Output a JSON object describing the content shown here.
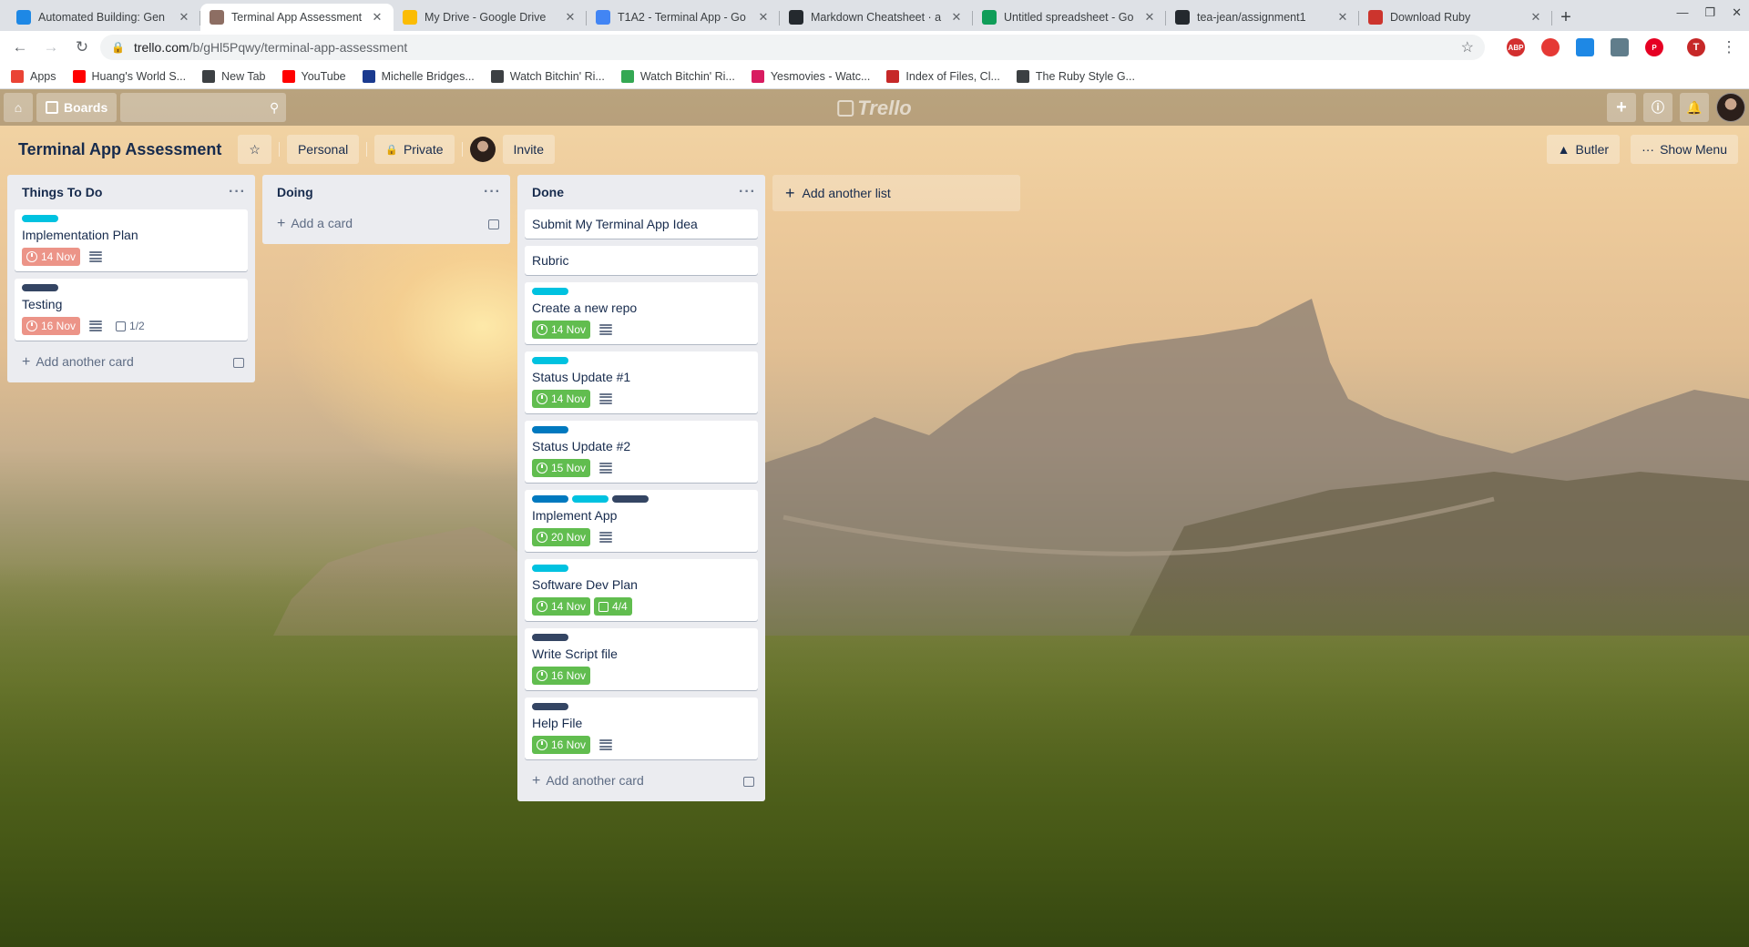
{
  "browser": {
    "tabs": [
      {
        "title": "Automated Building: Gen",
        "favicon_color": "#1e88e5",
        "active": false
      },
      {
        "title": "Terminal App Assessment",
        "favicon_color": "#8d6e63",
        "active": true
      },
      {
        "title": "My Drive - Google Drive",
        "favicon_color": "#fbbc04",
        "active": false
      },
      {
        "title": "T1A2 - Terminal App - Go",
        "favicon_color": "#4285f4",
        "active": false
      },
      {
        "title": "Markdown Cheatsheet · a",
        "favicon_color": "#24292e",
        "active": false
      },
      {
        "title": "Untitled spreadsheet - Go",
        "favicon_color": "#0f9d58",
        "active": false
      },
      {
        "title": "tea-jean/assignment1",
        "favicon_color": "#24292e",
        "active": false
      },
      {
        "title": "Download Ruby",
        "favicon_color": "#cc342d",
        "active": false
      }
    ],
    "url_host": "trello.com",
    "url_path": "/b/gHl5Pqwy/terminal-app-assessment",
    "profile_initial": "T",
    "bookmarks": [
      {
        "label": "Apps",
        "color": "#ea4335"
      },
      {
        "label": "Huang's World S...",
        "color": "#ff0000"
      },
      {
        "label": "New Tab",
        "color": "#3c4043"
      },
      {
        "label": "YouTube",
        "color": "#ff0000"
      },
      {
        "label": "Michelle Bridges...",
        "color": "#1a3a8f"
      },
      {
        "label": "Watch Bitchin' Ri...",
        "color": "#3c4043"
      },
      {
        "label": "Watch Bitchin' Ri...",
        "color": "#34a853"
      },
      {
        "label": "Yesmovies - Watc...",
        "color": "#d81b60"
      },
      {
        "label": "Index of Files, Cl...",
        "color": "#c62828"
      },
      {
        "label": "The Ruby Style G...",
        "color": "#3c4043"
      }
    ]
  },
  "header": {
    "boards_label": "Boards",
    "logo_text": "Trello"
  },
  "board": {
    "title": "Terminal App Assessment",
    "team_label": "Personal",
    "visibility_label": "Private",
    "invite_label": "Invite",
    "butler_label": "Butler",
    "show_menu_label": "Show Menu",
    "add_list_label": "Add another list"
  },
  "colors": {
    "label_sky": "#00c2e0",
    "label_navy": "#344563",
    "label_blue": "#0079bf",
    "due_late": "#ec9488",
    "due_complete": "#61bd4f"
  },
  "lists": [
    {
      "name": "Things To Do",
      "add_label": "Add another card",
      "cards": [
        {
          "title": "Implementation Plan",
          "labels": [
            "label_sky"
          ],
          "due": "14 Nov",
          "due_state": "late",
          "has_desc": true
        },
        {
          "title": "Testing",
          "labels": [
            "label_navy"
          ],
          "due": "16 Nov",
          "due_state": "late",
          "has_desc": true,
          "checklist": "1/2"
        }
      ]
    },
    {
      "name": "Doing",
      "add_label": "Add a card",
      "cards": []
    },
    {
      "name": "Done",
      "add_label": "Add another card",
      "cards": [
        {
          "title": "Submit My Terminal App Idea",
          "labels": []
        },
        {
          "title": "Rubric",
          "labels": []
        },
        {
          "title": "Create a new repo",
          "labels": [
            "label_sky"
          ],
          "due": "14 Nov",
          "due_state": "done",
          "has_desc": true
        },
        {
          "title": "Status Update #1",
          "labels": [
            "label_sky"
          ],
          "due": "14 Nov",
          "due_state": "done",
          "has_desc": true
        },
        {
          "title": "Status Update #2",
          "labels": [
            "label_blue"
          ],
          "due": "15 Nov",
          "due_state": "done",
          "has_desc": true
        },
        {
          "title": "Implement App",
          "labels": [
            "label_blue",
            "label_sky",
            "label_navy"
          ],
          "due": "20 Nov",
          "due_state": "done",
          "has_desc": true
        },
        {
          "title": "Software Dev Plan",
          "labels": [
            "label_sky"
          ],
          "due": "14 Nov",
          "due_state": "done",
          "checklist": "4/4",
          "checklist_state": "done"
        },
        {
          "title": "Write Script file",
          "labels": [
            "label_navy"
          ],
          "due": "16 Nov",
          "due_state": "done"
        },
        {
          "title": "Help File",
          "labels": [
            "label_navy"
          ],
          "due": "16 Nov",
          "due_state": "done",
          "has_desc": true
        }
      ]
    }
  ]
}
